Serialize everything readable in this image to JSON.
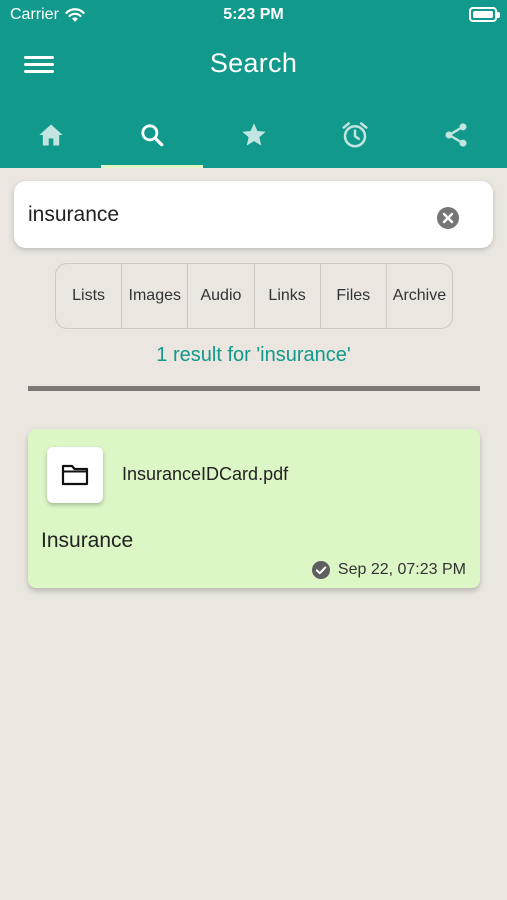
{
  "status_bar": {
    "carrier": "Carrier",
    "time": "5:23 PM"
  },
  "header": {
    "title": "Search",
    "menu_icon": "hamburger-menu-icon"
  },
  "tabs": [
    {
      "icon": "home-icon",
      "active": false
    },
    {
      "icon": "search-icon",
      "active": true
    },
    {
      "icon": "star-icon",
      "active": false
    },
    {
      "icon": "alarm-icon",
      "active": false
    },
    {
      "icon": "share-icon",
      "active": false
    }
  ],
  "search": {
    "value": "insurance",
    "clear_icon": "clear-icon"
  },
  "filters": [
    "Lists",
    "Images",
    "Audio",
    "Links",
    "Files",
    "Archive"
  ],
  "results": {
    "summary": "1 result for 'insurance'",
    "items": [
      {
        "filename": "InsuranceIDCard.pdf",
        "title": "Insurance",
        "date": "Sep 22, 07:23 PM",
        "icon": "folder-icon",
        "status_icon": "check-circle-icon"
      }
    ]
  },
  "colors": {
    "primary": "#11998b",
    "background": "#ebe6e0",
    "card": "#dcf6c6",
    "tab_indicator": "#e0f5c4"
  }
}
